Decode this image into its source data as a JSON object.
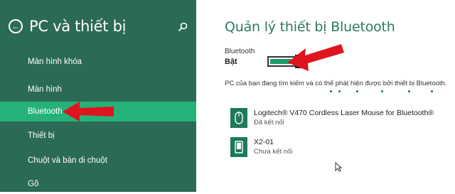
{
  "sidebar": {
    "title": "PC và thiết bị",
    "items": [
      {
        "label": "Màn hình khóa"
      },
      {
        "label": "Màn hình"
      },
      {
        "label": "Bluetooth",
        "active": true
      },
      {
        "label": "Thiết bị"
      },
      {
        "label": "Chuột và bàn di chuột"
      },
      {
        "label": "Gõ"
      }
    ]
  },
  "main": {
    "title": "Quản lý thiết bị Bluetooth",
    "bluetooth_label": "Bluetooth",
    "bluetooth_state": "Bật",
    "bluetooth_on": true,
    "searching_text": "PC của bạn đang tìm kiếm và có thể phát hiện được bởi thiết bị Bluetooth.",
    "devices": [
      {
        "name": "Logitech® V470 Cordless Laser Mouse for Bluetooth®",
        "status": "Đã kết nối",
        "icon": "mouse-icon"
      },
      {
        "name": "X2-01",
        "status": "Chưa kết nối",
        "icon": "phone-icon"
      }
    ]
  },
  "colors": {
    "sidebar_bg": "#2b6a55",
    "active_item": "#25b279",
    "accent": "#2c7a5f",
    "annotation_arrow": "#e0141e"
  }
}
